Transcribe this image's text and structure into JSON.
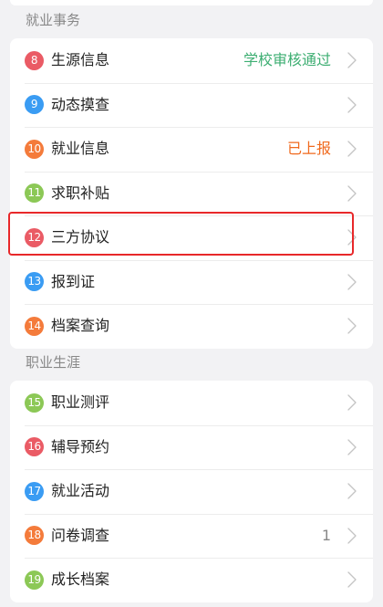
{
  "sections": [
    {
      "title": "就业事务",
      "items": [
        {
          "num": "8",
          "label": "生源信息",
          "value": "学校审核通过",
          "value_color": "#3dae72",
          "badge_color": "#ea5b65"
        },
        {
          "num": "9",
          "label": "动态摸查",
          "value": "",
          "value_color": "",
          "badge_color": "#3a9cf3"
        },
        {
          "num": "10",
          "label": "就业信息",
          "value": "已上报",
          "value_color": "#f06a1e",
          "badge_color": "#f47b3b"
        },
        {
          "num": "11",
          "label": "求职补贴",
          "value": "",
          "value_color": "",
          "badge_color": "#8cc856"
        },
        {
          "num": "12",
          "label": "三方协议",
          "value": "",
          "value_color": "",
          "badge_color": "#ea5b65"
        },
        {
          "num": "13",
          "label": "报到证",
          "value": "",
          "value_color": "",
          "badge_color": "#3a9cf3"
        },
        {
          "num": "14",
          "label": "档案查询",
          "value": "",
          "value_color": "",
          "badge_color": "#f47b3b"
        }
      ]
    },
    {
      "title": "职业生涯",
      "items": [
        {
          "num": "15",
          "label": "职业测评",
          "value": "",
          "value_color": "",
          "badge_color": "#8cc856"
        },
        {
          "num": "16",
          "label": "辅导预约",
          "value": "",
          "value_color": "",
          "badge_color": "#ea5b65"
        },
        {
          "num": "17",
          "label": "就业活动",
          "value": "",
          "value_color": "",
          "badge_color": "#3a9cf3"
        },
        {
          "num": "18",
          "label": "问卷调查",
          "value": "1",
          "value_color": "#888888",
          "badge_color": "#f47b3b"
        },
        {
          "num": "19",
          "label": "成长档案",
          "value": "",
          "value_color": "",
          "badge_color": "#8cc856"
        }
      ]
    }
  ],
  "colors": {
    "background": "#f2f2f4",
    "card": "#ffffff",
    "highlight": "#e8282a",
    "chevron": "#c4c4c4"
  },
  "icons": {
    "chevron": "chevron-right-icon"
  }
}
